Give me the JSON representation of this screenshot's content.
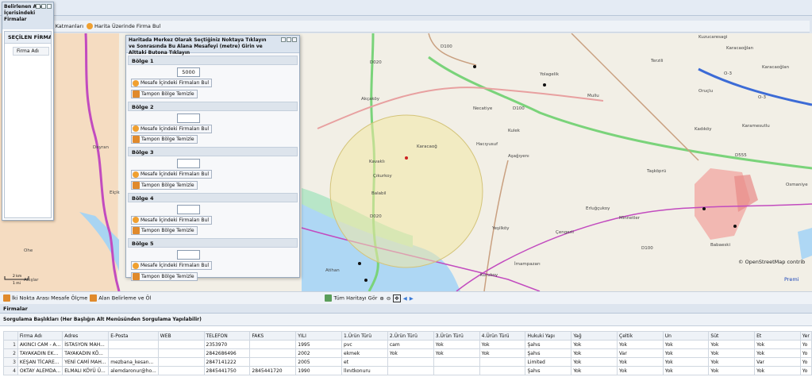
{
  "toolbar": {
    "layers": "ık Katmanları",
    "find_on_map": "Harita Üzerinde Firma Bul"
  },
  "map_labels": {
    "kuzucaresagi": "Kuzucaresagi",
    "karacaoglan1": "Karacaoğlan",
    "karacaoglan2": "Karacaoğlan",
    "terzili": "Terzili",
    "yolagelik": "Yolagelik",
    "mullu": "Mullu",
    "oruclu": "Oruçlu",
    "necatiye": "Necatiye",
    "kadikoy": "Kadıköy",
    "karamesutlu": "Karamesutlu",
    "kulak": "Kulek",
    "kuyumcu": "Hacıyusuf",
    "tasköprü": "Taşköprü",
    "kuleli": "Kuleli",
    "ahlatli": "Aşağıyenı",
    "erlugicukoy": "Erluğçukoy",
    "minnetler": "Minnetler",
    "osmaniye": "Osmaniye",
    "babaeski": "Babaeski",
    "yeskoy": "Yeşilköy",
    "cengel": "Çengerli",
    "imamgazi": "İmampazarı",
    "kurukoy": "Kurukoy",
    "atihan": "Atihan",
    "aksakoy": "Akçaköy",
    "kavakli": "Kavaklı",
    "cikurkoy": "Çıkurkoy",
    "balabil": "Balabil",
    "karacaoglu": "Karacaoğ",
    "deyan": "Deyran",
    "elbik": "Elçik",
    "ohe": "Ohe",
    "a4": "Akışlar",
    "osm_credit": "© OpenStreetMap contrib",
    "premium": "Premi",
    "scale_top": "2 km",
    "scale_bot": "1 mi",
    "road_d100a": "D100",
    "road_d100b": "D100",
    "road_d100c": "D100",
    "road_d555": "D555",
    "road_ov": "O-3",
    "road_ov2": "O-3",
    "road_d020": "D020",
    "road_d020b": "D020"
  },
  "bottom_toolbar": {
    "measure": "İki Nokta Arası Mesafe Ölçme",
    "area": "Alan Belirleme ve Öl",
    "all_map": "Tüm Haritayı Gör"
  },
  "left_window": {
    "title": "Belirlenen Alan İçerisindeki Firmalar",
    "section": "SEÇİLEN FİRMALAR",
    "col": "Firma Adı"
  },
  "center_window": {
    "title": "Haritada Merkez Olarak Seçtiğiniz Noktaya Tıklayın ve Sonrasında Bu Alana Mesafeyi (metre) Girin ve Alttaki Butona Tıklayın",
    "zones": [
      {
        "label": "Bölge 1",
        "value": "5000",
        "find": "Mesafe İçindeki Firmaları Bul",
        "clear": "Tampon Bölge Temizle"
      },
      {
        "label": "Bölge 2",
        "value": "",
        "find": "Mesafe İçindeki Firmaları Bul",
        "clear": "Tampon Bölge Temizle"
      },
      {
        "label": "Bölge 3",
        "value": "",
        "find": "Mesafe İçindeki Firmaları Bul",
        "clear": "Tampon Bölge Temizle"
      },
      {
        "label": "Bölge 4",
        "value": "",
        "find": "Mesafe İçindeki Firmaları Bul",
        "clear": "Tampon Bölge Temizle"
      },
      {
        "label": "Bölge 5",
        "value": "",
        "find": "Mesafe İçindeki Firmaları Bul",
        "clear": "Tampon Bölge Temizle"
      }
    ]
  },
  "firmalar": {
    "title": "Firmalar",
    "sort_hint": "Sorgulama Başlıkları (Her Başlığın Alt Menüsünden Sorgulama Yapılabilir)"
  },
  "grid": {
    "columns": [
      "",
      "Firma Adı",
      "Adres",
      "E-Posta",
      "WEB",
      "TELEFON",
      "FAKS",
      "YILI",
      "1.Ürün Türü",
      "2.Ürün Türü",
      "3.Ürün Türü",
      "4.Ürün Türü",
      "Hukuki Yapı",
      "Yağ",
      "Çeltik",
      "Un",
      "Süt",
      "Et",
      "Yer"
    ],
    "rows": [
      [
        "1",
        "AKINCI CAM - A...",
        "İSTASYON MAH...",
        "",
        "",
        "2353970",
        "",
        "1995",
        "pvc",
        "cam",
        "Yok",
        "Yok",
        "Şahıs",
        "Yok",
        "Yok",
        "Yok",
        "Yok",
        "Yok",
        "Yo"
      ],
      [
        "2",
        "TAYAKADIN EK...",
        "TAYAKADIN KÖ...",
        "",
        "",
        "2842686496",
        "",
        "2002",
        "ekmek",
        "Yok",
        "Yok",
        "Yok",
        "Şahıs",
        "Yok",
        "Var",
        "Yok",
        "Yok",
        "Yok",
        "Yo"
      ],
      [
        "3",
        "KEŞAN TİCARE...",
        "YENİ CAMİ MAH...",
        "mezbana_kesan...",
        "",
        "2847141222",
        "",
        "2005",
        "et",
        "",
        "",
        "",
        "Limited",
        "Yok",
        "Yok",
        "Yok",
        "Yok",
        "Var",
        "Yo"
      ],
      [
        "4",
        "OKTAY ALEMDA...",
        "ELMALI KÖYÜ Ü...",
        "alemdaronur@ho...",
        "",
        "2845441750",
        "2845441720",
        "1990",
        "llınıtkonuru",
        "",
        "",
        "",
        "Şahıs",
        "Yok",
        "Yok",
        "Yok",
        "Yok",
        "Yok",
        "Yo"
      ]
    ]
  }
}
